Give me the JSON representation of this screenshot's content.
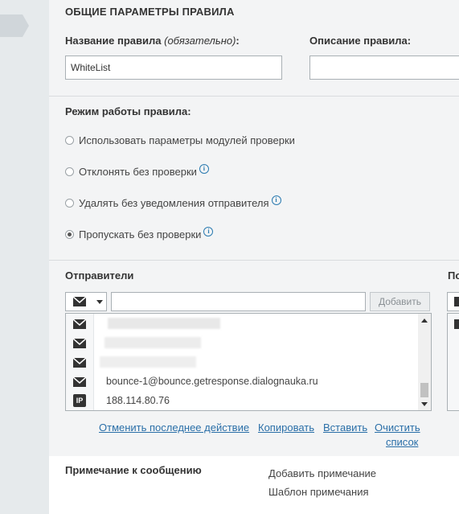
{
  "general": {
    "section_title": "ОБЩИЕ ПАРАМЕТРЫ ПРАВИЛА",
    "rule_name_label": "Название правила",
    "rule_name_required": "(обязательно)",
    "rule_name_colon": ":",
    "rule_name_value": "WhiteList",
    "description_label": "Описание правила:",
    "description_value": ""
  },
  "mode": {
    "label": "Режим работы правила:",
    "options": [
      {
        "label": "Использовать параметры модулей проверки",
        "checked": false,
        "info": false
      },
      {
        "label": "Отклонять без проверки",
        "checked": false,
        "info": true
      },
      {
        "label": "Удалять без уведомления отправителя",
        "checked": false,
        "info": true
      },
      {
        "label": "Пропускать без проверки",
        "checked": true,
        "info": true
      }
    ]
  },
  "senders": {
    "title": "Отправители",
    "right_title_partial": "По",
    "input_value": "",
    "add_button": "Добавить",
    "info_icon_glyph": "i",
    "type_icons": [
      "envelope-icon",
      "envelope-icon",
      "envelope-icon",
      "envelope-icon",
      "ip-icon"
    ],
    "ip_badge": "IP",
    "entries": [
      "",
      "",
      "",
      "bounce-1@bounce.getresponse.dialognauka.ru",
      "188.114.80.76"
    ],
    "actions": {
      "undo": "Отменить последнее действие",
      "copy": "Копировать",
      "paste": "Вставить",
      "clear_line1": "Очистить",
      "clear_line2": "список"
    }
  },
  "note": {
    "title": "Примечание к сообщению",
    "add_note": "Добавить примечание",
    "note_template": "Шаблон примечания"
  },
  "colors": {
    "link": "#2a6fa8",
    "info": "#2a7ab0",
    "panel_bg": "#f3f4f5",
    "nav_bg": "#e6eaec"
  }
}
